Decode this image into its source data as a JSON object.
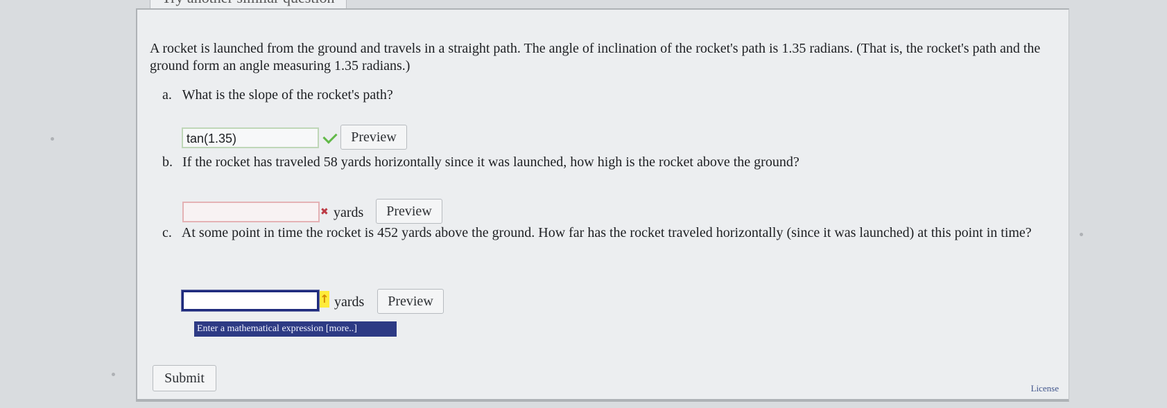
{
  "top_button": {
    "label": "Try another similar question"
  },
  "question": {
    "text": "A rocket is launched from the ground and travels in a straight path. The angle of inclination of the rocket's path is 1.35 radians. (That is, the rocket's path and the ground form an angle measuring 1.35 radians.)"
  },
  "parts": [
    {
      "letter": "a.",
      "prompt": "What is the slope of the rocket's path?",
      "answer": "tan(1.35)",
      "status_icon": "check-icon",
      "preview_label": "Preview"
    },
    {
      "letter": "b.",
      "prompt": "If the rocket has traveled 58 yards horizontally since it was launched, how high is the rocket above the ground?",
      "answer": "",
      "unit": "yards",
      "status_icon": "x-icon",
      "preview_label": "Preview"
    },
    {
      "letter": "c.",
      "prompt": "At some point in time the rocket is 452 yards above the ground. How far has the rocket traveled horizontally (since it was launched) at this point in time?",
      "answer": "",
      "unit": "yards",
      "status_icon": "arrow-icon",
      "hint": "Enter a mathematical expression [more..]",
      "preview_label": "Preview"
    }
  ],
  "submit_label": "Submit",
  "license_label": "License",
  "colors": {
    "panel_background": "#eceef0",
    "correct_green": "#62b949",
    "incorrect_red": "#bb3b45",
    "active_blue": "#1e2b7d",
    "hint_background": "#2d3a84",
    "license_blue": "#41568c"
  }
}
